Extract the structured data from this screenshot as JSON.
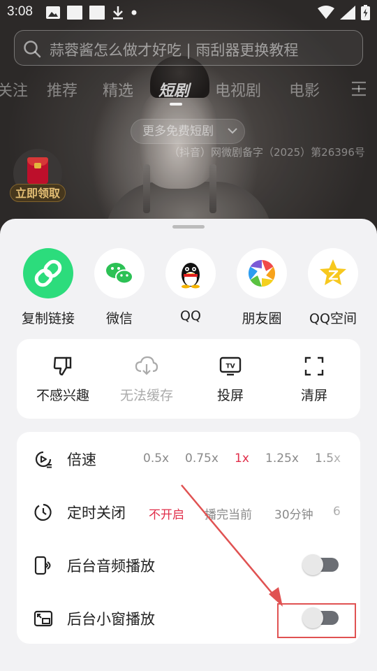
{
  "status_bar": {
    "time": "3:08"
  },
  "search": {
    "placeholder": "蒜蓉酱怎么做才好吃 | 雨刮器更换教程"
  },
  "top_tabs": [
    {
      "label": "关注"
    },
    {
      "label": "推荐"
    },
    {
      "label": "精选"
    },
    {
      "label": "短剧",
      "active": true
    },
    {
      "label": "电视剧"
    },
    {
      "label": "电影"
    }
  ],
  "more_button": {
    "label": "更多免费短剧"
  },
  "license": "（抖音）网微剧备字（2025）第26396号",
  "red_packet": {
    "label": "立即领取"
  },
  "share_targets": [
    {
      "label": "复制链接",
      "icon": "link-icon",
      "color": "#2cdc7c"
    },
    {
      "label": "微信",
      "icon": "wechat-icon",
      "color": "#2cc155"
    },
    {
      "label": "QQ",
      "icon": "qq-icon"
    },
    {
      "label": "朋友圈",
      "icon": "moments-icon"
    },
    {
      "label": "QQ空间",
      "icon": "qzone-icon",
      "color": "#f7c81e"
    }
  ],
  "actions": [
    {
      "label": "不感兴趣",
      "icon": "thumbs-down-icon",
      "enabled": true
    },
    {
      "label": "无法缓存",
      "icon": "cloud-download-icon",
      "enabled": false
    },
    {
      "label": "投屏",
      "icon": "tv-cast-icon",
      "enabled": true
    },
    {
      "label": "清屏",
      "icon": "fullscreen-icon",
      "enabled": true
    }
  ],
  "settings": {
    "speed": {
      "title": "倍速",
      "options": [
        "0.5x",
        "0.75x",
        "1x",
        "1.25x",
        "1.5x"
      ],
      "selected": "1x"
    },
    "timer": {
      "title": "定时关闭",
      "options": [
        "不开启",
        "播完当前",
        "30分钟",
        "6"
      ],
      "selected": "不开启"
    },
    "background_audio": {
      "title": "后台音频播放",
      "enabled": false
    },
    "pip": {
      "title": "后台小窗播放",
      "enabled": false
    }
  },
  "accent_color": "#e02e4a",
  "annotation_color": "#e05252"
}
